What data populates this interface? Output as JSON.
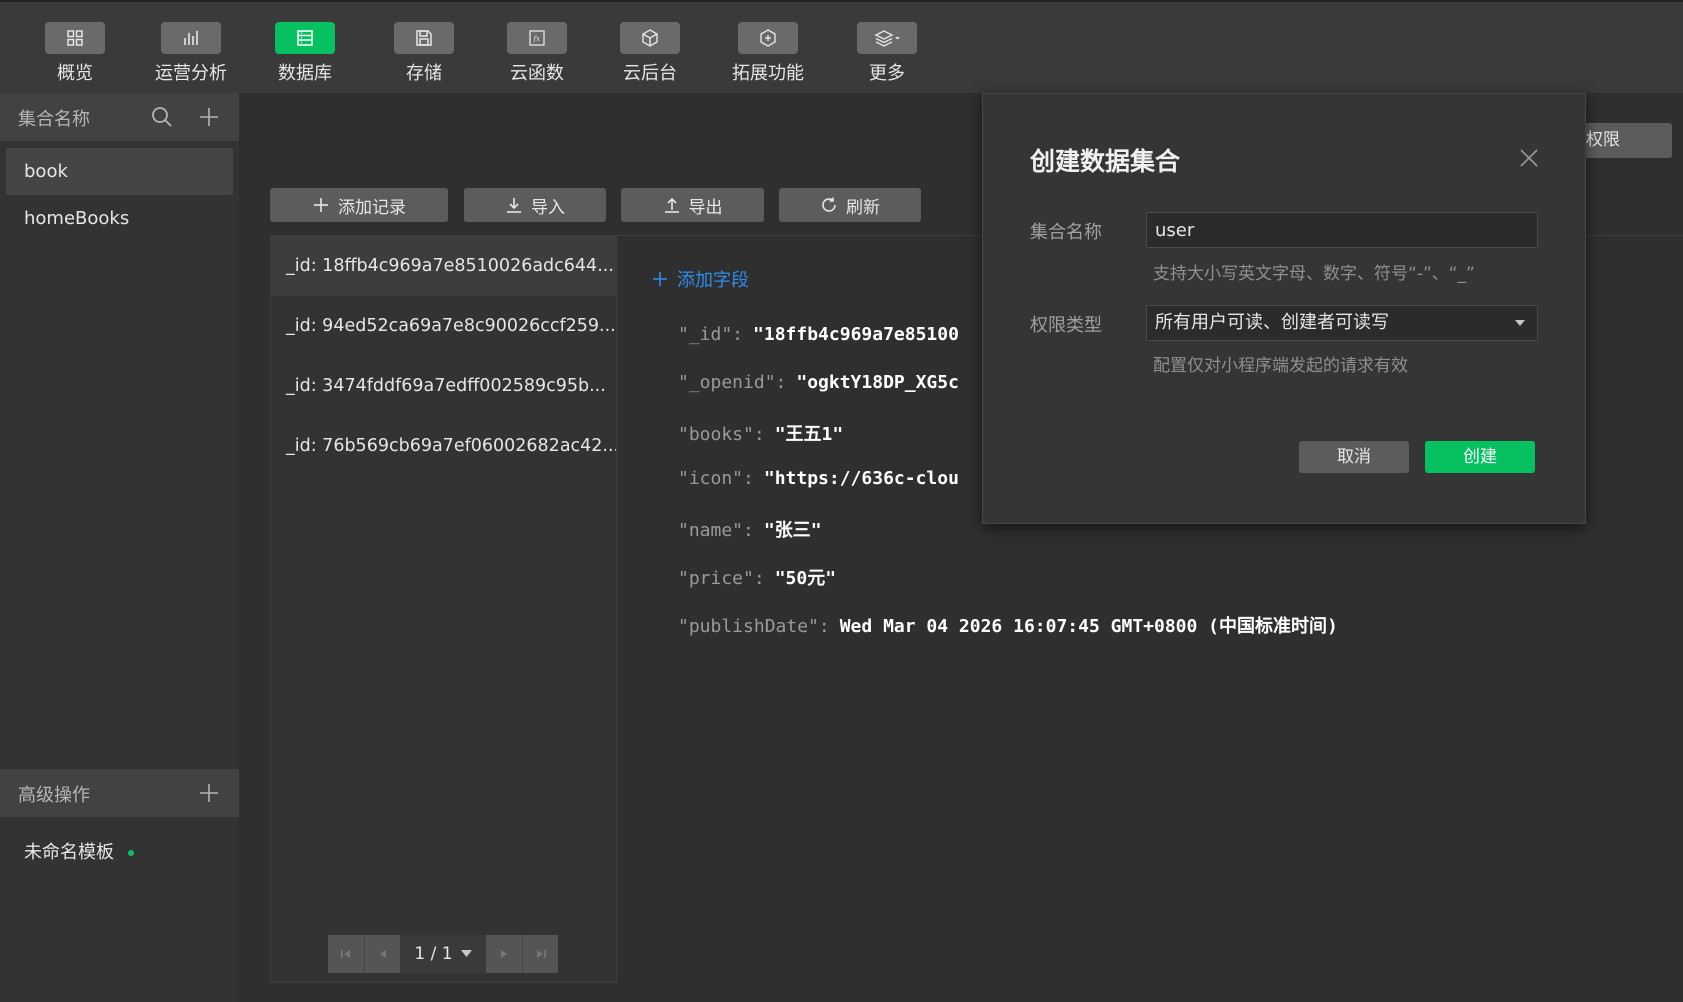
{
  "toolbar": {
    "items": [
      {
        "label": "概览",
        "icon": "grid-icon"
      },
      {
        "label": "运营分析",
        "icon": "bar-chart-icon"
      },
      {
        "label": "数据库",
        "icon": "database-icon",
        "active": true
      },
      {
        "label": "存储",
        "icon": "save-icon"
      },
      {
        "label": "云函数",
        "icon": "function-icon"
      },
      {
        "label": "云后台",
        "icon": "cube-icon"
      },
      {
        "label": "拓展功能",
        "icon": "extension-icon"
      },
      {
        "label": "更多",
        "icon": "layers-icon"
      }
    ]
  },
  "sidebar": {
    "collections_title": "集合名称",
    "collections": [
      {
        "name": "book",
        "selected": true
      },
      {
        "name": "homeBooks"
      }
    ],
    "advanced_title": "高级操作",
    "template_name": "未命名模板"
  },
  "actions": {
    "add_record": "添加记录",
    "import": "导入",
    "export": "导出",
    "refresh": "刷新",
    "permission_partial": "权限"
  },
  "records": [
    "_id: 18ffb4c969a7e8510026adc644...",
    "_id: 94ed52ca69a7e8c90026ccf259...",
    "_id: 3474fddf69a7edff002589c95b...",
    "_id: 76b569cb69a7ef06002682ac42..."
  ],
  "pager": {
    "text": "1 / 1"
  },
  "detail": {
    "add_field": "添加字段",
    "fields": [
      {
        "key": "\"_id\":",
        "value": "\"18ffb4c969a7e85100"
      },
      {
        "key": "\"_openid\":",
        "value": "\"ogktY18DP_XG5c"
      },
      {
        "key": "\"books\":",
        "value": "\"王五1\""
      },
      {
        "key": "\"icon\":",
        "value": "\"https://636c-clou"
      },
      {
        "key": "\"name\":",
        "value": "\"张三\""
      },
      {
        "key": "\"price\":",
        "value": "\"50元\""
      },
      {
        "key": "\"publishDate\":",
        "value": "Wed Mar 04 2026 16:07:45 GMT+0800 (中国标准时间)"
      }
    ]
  },
  "modal": {
    "title": "创建数据集合",
    "name_label": "集合名称",
    "name_value": "user",
    "name_hint": "支持大小写英文字母、数字、符号“-”、“_”",
    "perm_label": "权限类型",
    "perm_value": "所有用户可读、创建者可读写",
    "perm_hint": "配置仅对小程序端发起的请求有效",
    "cancel": "取消",
    "create": "创建"
  },
  "colors": {
    "accent": "#07c160",
    "link": "#2d8cf0",
    "background": "#2f2f2f"
  }
}
